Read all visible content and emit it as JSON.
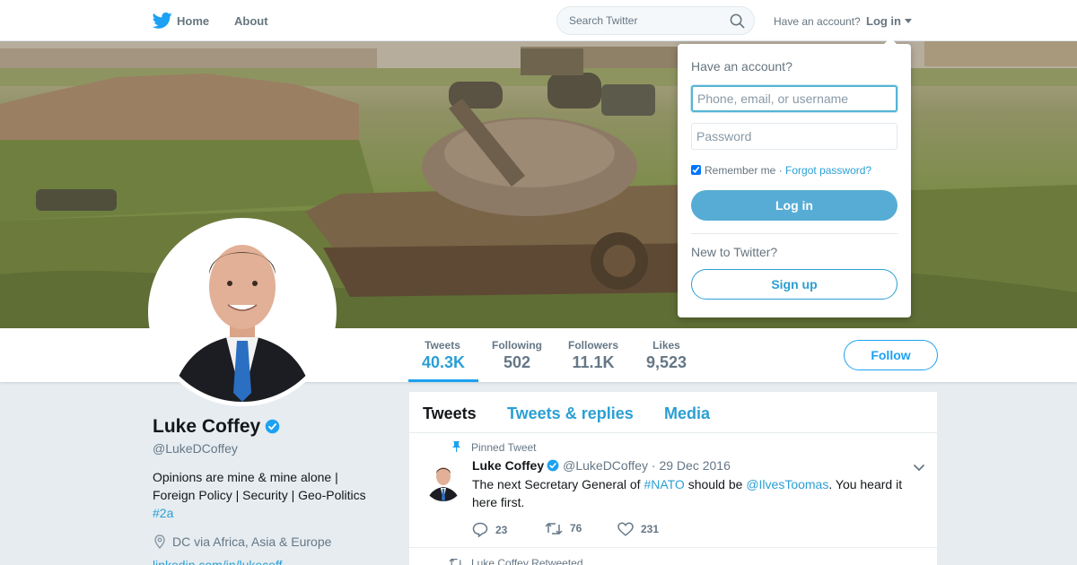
{
  "nav": {
    "home_label": "Home",
    "about_label": "About",
    "search_placeholder": "Search Twitter",
    "have_account": "Have an account?",
    "login_label": "Log in"
  },
  "profile_nav": {
    "stats": [
      {
        "label": "Tweets",
        "value": "40.3K"
      },
      {
        "label": "Following",
        "value": "502"
      },
      {
        "label": "Followers",
        "value": "11.1K"
      },
      {
        "label": "Likes",
        "value": "9,523"
      }
    ],
    "follow_label": "Follow"
  },
  "profile": {
    "name": "Luke Coffey",
    "handle": "@LukeDCoffey",
    "bio_line1": "Opinions are mine & mine alone |",
    "bio_line2": "Foreign Policy | Security | Geo-Politics",
    "bio_tag": "#2a",
    "location": "DC via Africa, Asia & Europe",
    "url_partial": "linkedin.com/in/lukecoff..."
  },
  "timeline": {
    "tabs": [
      "Tweets",
      "Tweets & replies",
      "Media"
    ],
    "pinned_label": "Pinned Tweet",
    "tweet": {
      "author": "Luke Coffey",
      "handle": "@LukeDCoffey",
      "separator": "·",
      "date": "29 Dec 2016",
      "text_1": "The next Secretary General of ",
      "link_1": "#NATO",
      "text_2": " should be ",
      "link_2": "@IlvesToomas",
      "text_3": ". You heard it here first.",
      "replies": "23",
      "retweets": "76",
      "likes": "231"
    },
    "retweeted_label": "Luke Coffey Retweeted"
  },
  "login_dropdown": {
    "title": "Have an account?",
    "username_placeholder": "Phone, email, or username",
    "password_placeholder": "Password",
    "remember_label": "Remember me",
    "dot": "·",
    "forgot_label": "Forgot password?",
    "login_button": "Log in",
    "new_label": "New to Twitter?",
    "signup_button": "Sign up"
  },
  "colors": {
    "accent": "#1da1f2",
    "link": "#2b9fd4",
    "login_button": "#56acd4",
    "page_background": "#e6ecf0"
  },
  "icons": [
    "twitter-bird-icon",
    "search-icon",
    "chevron-down-icon",
    "verified-badge-icon",
    "location-pin-icon",
    "pin-icon",
    "reply-icon",
    "retweet-icon",
    "like-icon"
  ]
}
